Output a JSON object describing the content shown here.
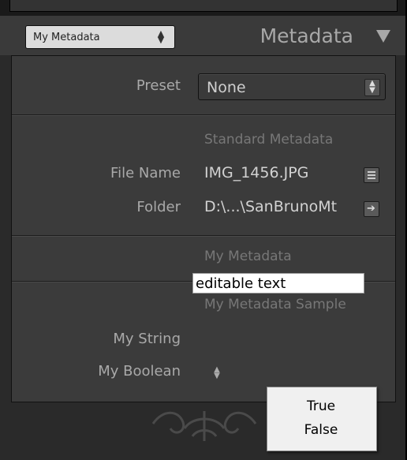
{
  "header": {
    "preset_menu": "My Metadata",
    "panel_title": "Metadata"
  },
  "preset_row": {
    "label": "Preset",
    "value": "None"
  },
  "standard_section": {
    "title": "Standard Metadata",
    "file_name_label": "File Name",
    "file_name_value": "IMG_1456.JPG",
    "folder_label": "Folder",
    "folder_value": "D:\\...\\SanBrunoMt"
  },
  "my_metadata_section": {
    "title": "My Metadata"
  },
  "sample_section": {
    "title": "My Metadata Sample",
    "string_label": "My String",
    "string_value": "editable text",
    "boolean_label": "My Boolean"
  },
  "popup_menu": {
    "options": [
      "True",
      "False"
    ]
  },
  "icons": {
    "collapse": "triangle-down-icon",
    "list": "list-icon",
    "goto": "arrow-right-icon",
    "stepper": "up-down-stepper-icon"
  }
}
